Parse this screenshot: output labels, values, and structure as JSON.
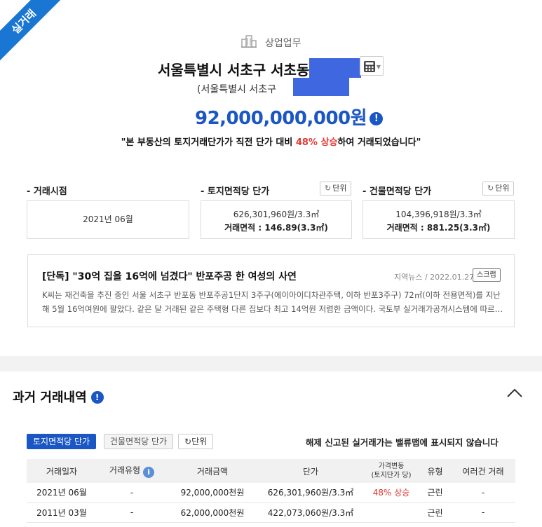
{
  "ribbon": "실거래",
  "category": {
    "icon": "building-icon",
    "label": "상업업무"
  },
  "address": {
    "main": "서울특별시 서초구 서초동",
    "sub": "(서울특별시 서초구",
    "calc_icon": "calculator-icon"
  },
  "price": "92,000,000,000원",
  "notice": {
    "before": "\"본 부동산의 토지거래단가가 직전 단가 대비 ",
    "highlight": "48% 상승",
    "after": "하여 거래되었습니다\""
  },
  "stats": {
    "trade_date": {
      "label": "- 거래시점",
      "value": "2021년 06월"
    },
    "land_unit": {
      "label": "- 토지면적당 단가",
      "unit_btn": "단위",
      "value": "626,301,960원/3.3㎡",
      "area": "거래면적 : 146.89(3.3㎡)"
    },
    "building_unit": {
      "label": "- 건물면적당 단가",
      "unit_btn": "단위",
      "value": "104,396,918원/3.3㎡",
      "area": "거래면적 : 881.25(3.3㎡)"
    }
  },
  "news": {
    "title": "[단독] \"30억 집을 16억에 넘겼다\" 반포주공 한 여성의 사연",
    "source": "지역뉴스 / 2022.01.27",
    "scrap": "스크랩",
    "line1": "K씨는 재건축을 추진 중인 서울 서초구 반포동 반포주공1단지 3주구(에이아이디차관주택, 이하 반포3주구) 72㎡(이하 전용면적)를 지난",
    "line2": "해 5월 16억여원에 팔았다. 같은 달 거래된 같은 주택형 다른 집보다 최고 14억원 저렴한 금액이다. 국토부 실거래가공개시스템에 따르…"
  },
  "history": {
    "title": "과거 거래내역",
    "tabs": {
      "land": "토지면적당 단가",
      "building": "건물면적당 단가",
      "unit": "단위"
    },
    "note": "해제 신고된 실거래가는 밸류맵에 표시되지 않습니다",
    "headers": {
      "date": "거래일자",
      "type": "거래유형",
      "amount": "거래금액",
      "unit_price": "단가",
      "change1": "가격변동",
      "change2": "(토지단가 당)",
      "use": "유형",
      "multi": "여러건 거래"
    },
    "rows": [
      {
        "date": "2021년 06월",
        "type": "-",
        "amount": "92,000,000천원",
        "unit_price": "626,301,960원/3.3㎡",
        "change": "48% 상승",
        "use": "근린",
        "multi": "-"
      },
      {
        "date": "2011년 03월",
        "type": "-",
        "amount": "62,000,000천원",
        "unit_price": "422,073,060원/3.3㎡",
        "change": "",
        "use": "근린",
        "multi": "-"
      }
    ]
  },
  "colors": {
    "accent": "#1a56c4",
    "ribbon": "#1976d2",
    "up": "#e53935",
    "mask": "#3f68e0"
  }
}
